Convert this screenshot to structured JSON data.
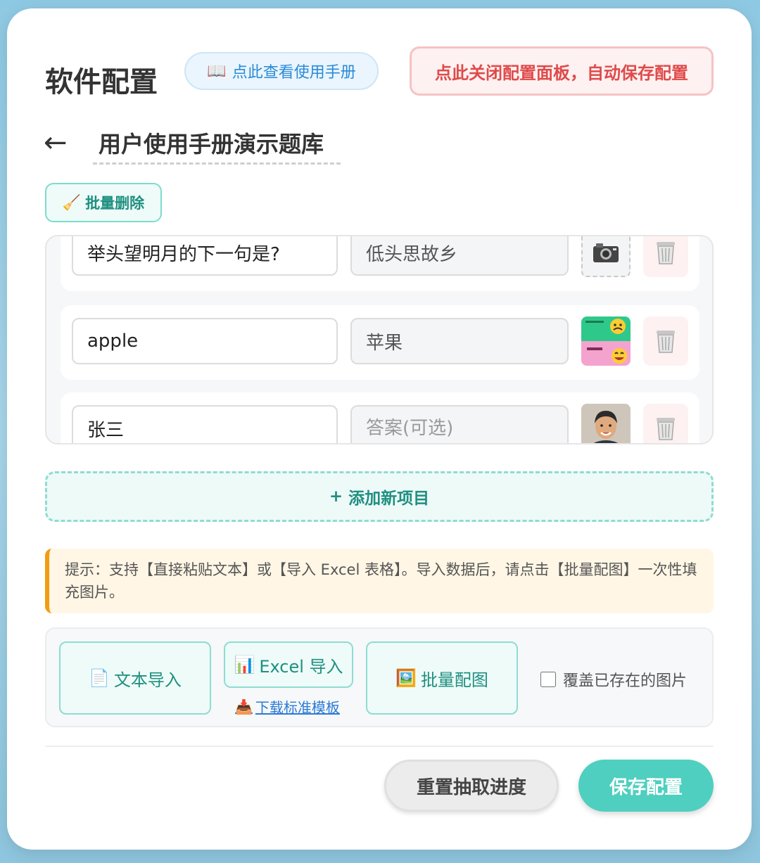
{
  "header": {
    "title": "软件配置",
    "manual_icon": "📖",
    "manual_label": "点此查看使用手册",
    "close_label": "点此关闭配置面板，自动保存配置"
  },
  "bank": {
    "back_icon": "←",
    "name_value": "用户使用手册演示题库"
  },
  "toolbar": {
    "bulk_delete_icon": "🧹",
    "bulk_delete_label": "批量删除"
  },
  "items": [
    {
      "question": "举头望明月的下一句是?",
      "answer": "低头思故乡",
      "answer_placeholder": "答案(可选)",
      "image": "camera-placeholder-icon"
    },
    {
      "question": "apple",
      "answer": "苹果",
      "answer_placeholder": "答案(可选)",
      "image": "app-screenshot-thumbnail"
    },
    {
      "question": "张三",
      "answer": "",
      "answer_placeholder": "答案(可选)",
      "image": "avatar-photo-thumbnail"
    }
  ],
  "add_item": {
    "icon": "+",
    "label": "添加新项目"
  },
  "tip": {
    "text": "提示：支持【直接粘贴文本】或【导入 Excel 表格】。导入数据后，请点击【批量配图】一次性填充图片。"
  },
  "import": {
    "text_import_icon": "📄",
    "text_import_label": "文本导入",
    "excel_import_icon": "📊",
    "excel_import_label": "Excel 导入",
    "download_icon": "📥",
    "download_label": "下载标准模板",
    "batch_image_icon": "🖼️",
    "batch_image_label": "批量配图",
    "overwrite_label": "覆盖已存在的图片",
    "overwrite_checked": false
  },
  "footer": {
    "reset_label": "重置抽取进度",
    "save_label": "保存配置"
  },
  "colors": {
    "accent": "#4fcfbf",
    "danger": "#e04a4a",
    "link": "#2b7bd6",
    "tip_bar": "#f39c12"
  }
}
